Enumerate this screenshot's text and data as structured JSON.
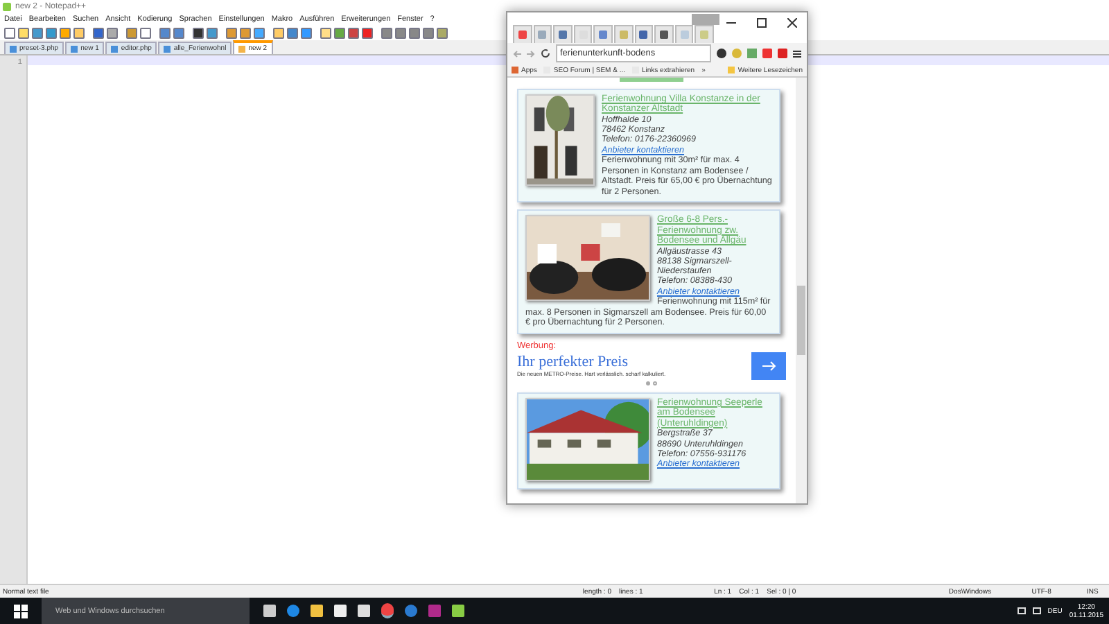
{
  "editor": {
    "title": "new 2 - Notepad++",
    "menu": [
      "Datei",
      "Bearbeiten",
      "Suchen",
      "Ansicht",
      "Kodierung",
      "Sprachen",
      "Einstellungen",
      "Makro",
      "Ausführen",
      "Erweiterungen",
      "Fenster",
      "?"
    ],
    "tabs": [
      {
        "label": "preset-3.php",
        "selected": false
      },
      {
        "label": "new 1",
        "selected": false
      },
      {
        "label": "editor.php",
        "selected": false
      },
      {
        "label": "alle_Ferienwohnl",
        "selected": false
      },
      {
        "label": "new 2",
        "selected": true
      }
    ],
    "line_numbers": [
      "1"
    ],
    "status_bar": [
      "Normal text file",
      "length : 0    lines : 1",
      "Ln : 1    Col : 1    Sel : 0 | 0",
      "Dos\\Windows",
      "UTF-8",
      "INS"
    ]
  },
  "browser": {
    "address": "ferienunterkunft-bodens",
    "bookmarks": [
      {
        "label": "Apps",
        "kind": "apps"
      },
      {
        "label": "SEO Forum | SEM & ...",
        "kind": "page"
      },
      {
        "label": "Links extrahieren",
        "kind": "page"
      },
      {
        "label": "»",
        "kind": "more"
      },
      {
        "label": "Weitere Lesezeichen",
        "kind": "folder"
      }
    ],
    "listings": [
      {
        "title": "Ferienwohnung Villa Konstanze in der Konstanzer Altstadt",
        "lines": [
          "Hoffhalde 10",
          "78462 Konstanz",
          "Telefon: 0176-22360969"
        ],
        "contact": "Anbieter kontaktieren",
        "description": "Ferienwohnung mit 30m² für max. 4 Personen in Konstanz am Bodensee / Altstadt. Preis für 65,00 € pro Übernachtung für 2 Personen."
      },
      {
        "title": "Große 6-8 Pers.- Ferienwohnung zw. Bodensee und Allgäu",
        "lines": [
          "Allgäustrasse 43",
          "88138 Sigmarszell-Niederstaufen",
          "Telefon: 08388-430"
        ],
        "contact": "Anbieter kontaktieren",
        "description": "Ferienwohnung mit 115m² für max. 8 Personen in Sigmarszell am Bodensee. Preis für 60,00 € pro Übernachtung für 2 Personen."
      },
      {
        "title": "Ferienwohnung Seeperle am Bodensee (Unteruhldingen)",
        "lines": [
          "Bergstraße 37",
          "88690 Unteruhldingen",
          "Telefon: 07556-931176"
        ],
        "contact": "Anbieter kontaktieren"
      }
    ],
    "ad": {
      "label": "Werbung:",
      "headline": "Ihr perfekter Preis",
      "text": "Die neuen METRO-Preise. Hart verlässlich. scharf kalkuliert.",
      "dots": [
        {
          "selected": true
        },
        {
          "selected": false
        }
      ]
    }
  },
  "taskbar": {
    "search": {
      "placeholder": "Web und Windows durchsuchen"
    },
    "language": "DEU",
    "time": "12:20",
    "date": "01.11.2015"
  }
}
